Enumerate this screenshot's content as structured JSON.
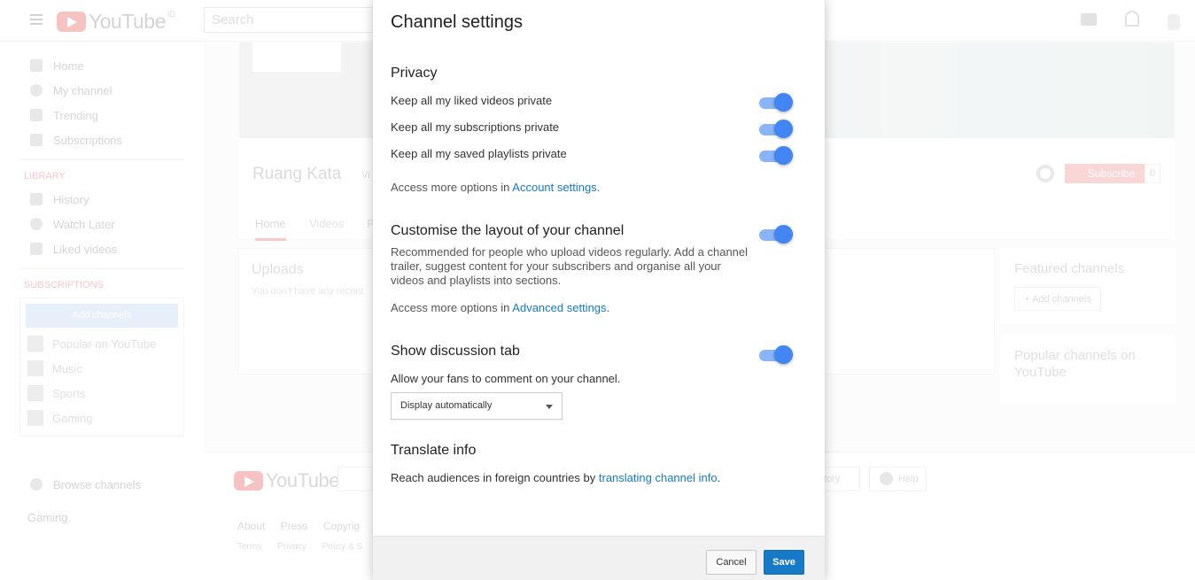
{
  "background": {
    "logo_text": "YouTube",
    "logo_region": "ID",
    "search_placeholder": "Search",
    "sidebar": {
      "items": [
        {
          "label": "Home",
          "icon": "home-icon"
        },
        {
          "label": "My channel",
          "icon": "account-icon"
        },
        {
          "label": "Trending",
          "icon": "flame-icon"
        },
        {
          "label": "Subscriptions",
          "icon": "subscriptions-icon"
        }
      ],
      "library_heading": "LIBRARY",
      "library_items": [
        {
          "label": "History",
          "icon": "hourglass-icon"
        },
        {
          "label": "Watch Later",
          "icon": "clock-icon"
        },
        {
          "label": "Liked videos",
          "icon": "thumbs-up-icon"
        }
      ],
      "subscriptions_heading": "SUBSCRIPTIONS",
      "add_channels": "Add channels",
      "subscription_items": [
        {
          "label": "Popular on YouTube"
        },
        {
          "label": "Music"
        },
        {
          "label": "Sports"
        },
        {
          "label": "Gaming"
        }
      ],
      "browse_channels": "Browse channels",
      "gaming": "Gaming"
    },
    "channel": {
      "name": "Ruang Kata",
      "views_prefix": "Vi",
      "tabs": [
        "Home",
        "Videos",
        "P"
      ],
      "subscribe": "Subscribe",
      "subscriber_count": "0",
      "uploads_title": "Uploads",
      "uploads_empty": "You don't have any recent",
      "featured_title": "Featured channels",
      "add_channels": "+ Add channels",
      "popular_title": "Popular channels on YouTube"
    },
    "footer": {
      "logo_text": "YouTube",
      "history": "tory",
      "help": "Help",
      "links_row1": [
        "About",
        "Press",
        "Copyrig"
      ],
      "links_row2": [
        "Terms",
        "Privacy",
        "Policy & S"
      ]
    }
  },
  "dialog": {
    "title": "Channel settings",
    "privacy": {
      "heading": "Privacy",
      "options": [
        {
          "label": "Keep all my liked videos private",
          "on": true
        },
        {
          "label": "Keep all my subscriptions private",
          "on": true
        },
        {
          "label": "Keep all my saved playlists private",
          "on": true
        }
      ],
      "more_prefix": "Access more options in ",
      "more_link": "Account settings",
      "more_suffix": "."
    },
    "layout": {
      "heading": "Customise the layout of your channel",
      "on": true,
      "description": "Recommended for people who upload videos regularly. Add a channel trailer, suggest content for your subscribers and organise all your videos and playlists into sections.",
      "more_prefix": "Access more options in ",
      "more_link": "Advanced settings",
      "more_suffix": "."
    },
    "discussion": {
      "heading": "Show discussion tab",
      "on": true,
      "description": "Allow your fans to comment on your channel.",
      "select_value": "Display automatically"
    },
    "translate": {
      "heading": "Translate info",
      "prefix": "Reach audiences in foreign countries by ",
      "link": "translating channel info",
      "suffix": "."
    },
    "buttons": {
      "cancel": "Cancel",
      "save": "Save"
    }
  },
  "colors": {
    "accent_blue": "#4285f4",
    "link_blue": "#167ac6",
    "youtube_red": "#ff0000"
  }
}
